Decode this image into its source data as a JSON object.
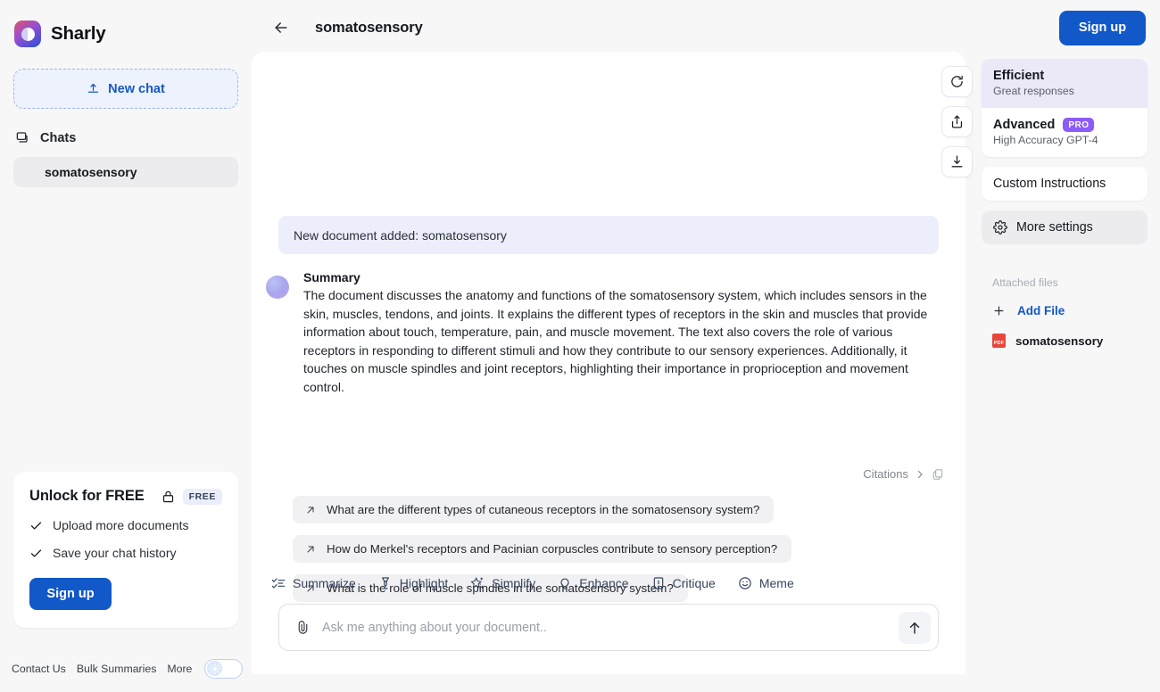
{
  "brand": {
    "name": "Sharly",
    "logo_icon": "sharly-logo-icon"
  },
  "sidebar": {
    "new_chat": {
      "label": "New chat",
      "icon": "upload-icon"
    },
    "chats_header": {
      "label": "Chats",
      "icon": "chat-bubbles-icon"
    },
    "chat_items": [
      {
        "label": "somatosensory",
        "active": true
      }
    ],
    "promo": {
      "title": "Unlock for FREE",
      "lock_icon": "lock-icon",
      "badge": "FREE",
      "features": [
        "Upload more documents",
        "Save your chat history"
      ],
      "cta_label": "Sign up"
    },
    "footer": {
      "links": [
        "Contact Us",
        "Bulk Summaries",
        "More"
      ],
      "theme_toggle": {
        "state": "light",
        "icon": "sun-icon"
      }
    }
  },
  "header": {
    "back_icon": "arrow-left-icon",
    "title": "somatosensory",
    "signup_label": "Sign up"
  },
  "tools": [
    {
      "name": "regenerate-button",
      "icon": "refresh-icon"
    },
    {
      "name": "share-button",
      "icon": "share-icon"
    },
    {
      "name": "download-button",
      "icon": "download-icon"
    }
  ],
  "chat": {
    "system_banner": "New document added: somatosensory",
    "message": {
      "title": "Summary",
      "text": "The document discusses the anatomy and functions of the somatosensory system, which includes sensors in the skin, muscles, tendons, and joints. It explains the different types of receptors in the skin and muscles that provide information about touch, temperature, pain, and muscle movement. The text also covers the role of various receptors in responding to different stimuli and how they contribute to our sensory experiences. Additionally, it touches on muscle spindles and joint receptors, highlighting their importance in proprioception and movement control."
    },
    "citations": {
      "label": "Citations",
      "chevron_icon": "chevron-right-icon",
      "copy_icon": "copy-icon"
    },
    "suggestions": [
      "What are the different types of cutaneous receptors in the somatosensory system?",
      "How do Merkel's receptors and Pacinian corpuscles contribute to sensory perception?",
      "What is the role of muscle spindles in the somatosensory system?"
    ],
    "actions": [
      {
        "label": "Summarize",
        "icon": "checklist-icon"
      },
      {
        "label": "Highlight",
        "icon": "highlighter-icon"
      },
      {
        "label": "Simplify",
        "icon": "sparkle-star-icon"
      },
      {
        "label": "Enhance",
        "icon": "lightbulb-icon"
      },
      {
        "label": "Critique",
        "icon": "clipboard-alert-icon"
      },
      {
        "label": "Meme",
        "icon": "smiley-icon"
      }
    ],
    "composer": {
      "attach_icon": "paperclip-icon",
      "value": "",
      "placeholder": "Ask me anything about your document..",
      "send_icon": "arrow-up-icon"
    }
  },
  "rail": {
    "models": [
      {
        "name": "Efficient",
        "sub": "Great responses",
        "badge": "",
        "active": true
      },
      {
        "name": "Advanced",
        "sub": "High Accuracy GPT-4",
        "badge": "PRO",
        "active": false
      }
    ],
    "custom_instructions": "Custom Instructions",
    "more_settings": {
      "label": "More settings",
      "icon": "gear-icon"
    },
    "attached_title": "Attached files",
    "add_file": {
      "label": "Add File",
      "icon": "plus-icon"
    },
    "files": [
      {
        "label": "somatosensory",
        "type": "PDF"
      }
    ]
  },
  "colors": {
    "brand_blue": "#1158c8",
    "accent_purple": "#8b5cf6",
    "banner_bg": "#eceefb",
    "active_model_bg": "#ebe8f8",
    "pdf_red": "#e8453c"
  }
}
